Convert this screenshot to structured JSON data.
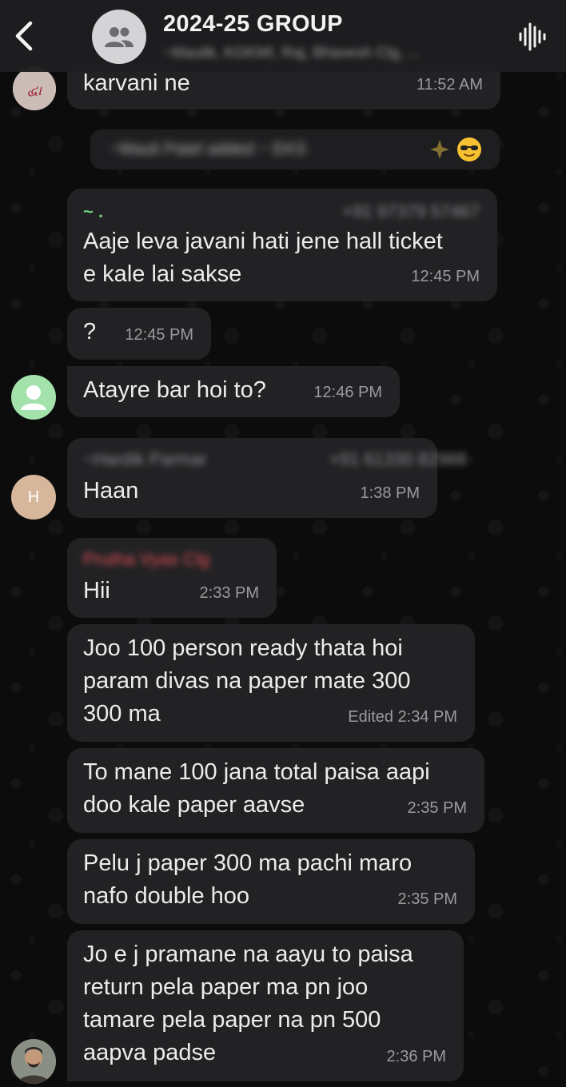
{
  "header": {
    "title": "2024-25 GROUP",
    "subtitle": "~Maulik, KGKMI, Raj, Bhavesh Clg, ..."
  },
  "messages": [
    {
      "text": "karvani ne",
      "time": "11:52 AM"
    },
    {
      "system_text": "~Mauli Patel added ~ EKS",
      "system_emoji": "sunglasses-emoji"
    },
    {
      "sender_name": "~ .",
      "sender_phone": "+91 97379 57467",
      "text": "Aaje leva javani hati jene hall ticket\ne kale lai sakse",
      "time": "12:45 PM"
    },
    {
      "text": "?",
      "time": "12:45 PM"
    },
    {
      "text": "Atayre bar hoi to?",
      "time": "12:46 PM"
    },
    {
      "sender_name": "~Hardik Parmar",
      "sender_phone": "+91 61330 82988",
      "text": "Haan",
      "time": "1:38 PM"
    },
    {
      "sender_name": "Prutha Vyas Clg",
      "text": "Hii",
      "time": "2:33 PM"
    },
    {
      "text": "Joo 100 person ready thata hoi\nparam divas  na paper mate 300\n300 ma",
      "time": "Edited 2:34 PM"
    },
    {
      "text": "To mane 100 jana total paisa aapi\ndoo kale paper aavse",
      "time": "2:35 PM"
    },
    {
      "text": "Pelu j paper  300 ma pachi maro\nnafo double hoo",
      "time": "2:35 PM"
    },
    {
      "text": "Jo e j pramane na aayu to paisa\nreturn pela paper ma pn joo\ntamare pela paper na pn 500\naapva padse",
      "time": "2:36 PM"
    }
  ],
  "avatars": {
    "first_avatar_text": "દ્વા",
    "h_avatar_letter": "H"
  },
  "colors": {
    "bubble": "#222224",
    "sender_green": "#6fd17b",
    "sender_red": "#e0505a",
    "sender_gray": "#8c8c90",
    "avatar_h_bg": "#d6b79b",
    "default_avatar_bg": "#a4e2ac"
  }
}
